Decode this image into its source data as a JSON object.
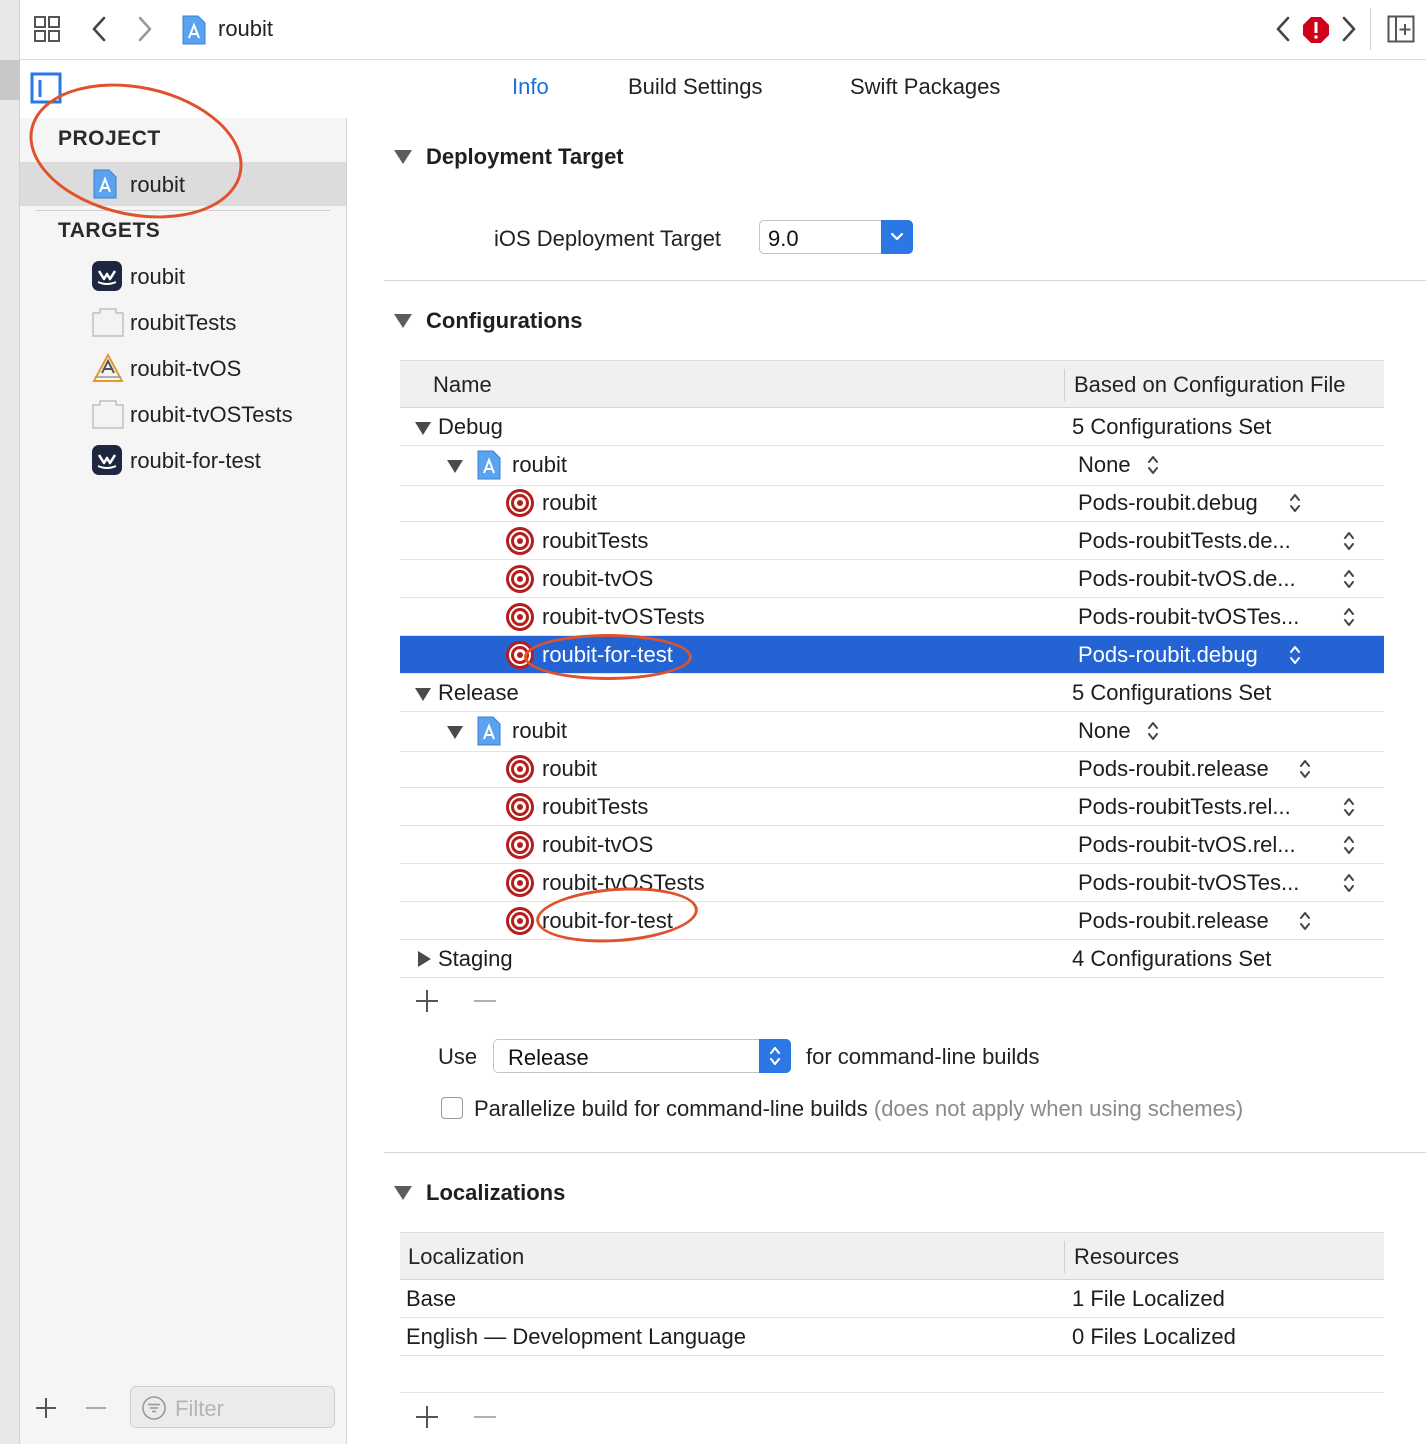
{
  "window": {
    "title": "roubit"
  },
  "tabs": [
    {
      "label": "Info",
      "active": true
    },
    {
      "label": "Build Settings",
      "active": false
    },
    {
      "label": "Swift Packages",
      "active": false
    }
  ],
  "sidebar": {
    "project_header": "PROJECT",
    "project_item": {
      "label": "roubit",
      "icon": "xcode-project-icon"
    },
    "targets_header": "TARGETS",
    "targets": [
      {
        "label": "roubit",
        "icon": "app-icon"
      },
      {
        "label": "roubitTests",
        "icon": "test-bundle-icon"
      },
      {
        "label": "roubit-tvOS",
        "icon": "tvos-app-icon"
      },
      {
        "label": "roubit-tvOSTests",
        "icon": "test-bundle-icon"
      },
      {
        "label": "roubit-for-test",
        "icon": "app-icon"
      }
    ],
    "filter_placeholder": "Filter"
  },
  "deployment": {
    "header": "Deployment Target",
    "ios_label": "iOS Deployment Target",
    "ios_value": "9.0"
  },
  "configurations": {
    "header": "Configurations",
    "columns": [
      "Name",
      "Based on Configuration File"
    ],
    "rows": [
      {
        "kind": "group",
        "name": "Debug",
        "value": "5 Configurations Set"
      },
      {
        "kind": "project",
        "name": "roubit",
        "value": "None"
      },
      {
        "kind": "target",
        "name": "roubit",
        "value": "Pods-roubit.debug"
      },
      {
        "kind": "target",
        "name": "roubitTests",
        "value": "Pods-roubitTests.de..."
      },
      {
        "kind": "target",
        "name": "roubit-tvOS",
        "value": "Pods-roubit-tvOS.de..."
      },
      {
        "kind": "target",
        "name": "roubit-tvOSTests",
        "value": "Pods-roubit-tvOSTes..."
      },
      {
        "kind": "target",
        "name": "roubit-for-test",
        "value": "Pods-roubit.debug",
        "selected": true
      },
      {
        "kind": "group",
        "name": "Release",
        "value": "5 Configurations Set"
      },
      {
        "kind": "project",
        "name": "roubit",
        "value": "None"
      },
      {
        "kind": "target",
        "name": "roubit",
        "value": "Pods-roubit.release"
      },
      {
        "kind": "target",
        "name": "roubitTests",
        "value": "Pods-roubitTests.rel..."
      },
      {
        "kind": "target",
        "name": "roubit-tvOS",
        "value": "Pods-roubit-tvOS.rel..."
      },
      {
        "kind": "target",
        "name": "roubit-tvOSTests",
        "value": "Pods-roubit-tvOSTes..."
      },
      {
        "kind": "target",
        "name": "roubit-for-test",
        "value": "Pods-roubit.release"
      },
      {
        "kind": "group-collapsed",
        "name": "Staging",
        "value": "4 Configurations Set"
      }
    ],
    "use_label": "Use",
    "use_value": "Release",
    "use_suffix": "for command-line builds",
    "parallelize_label": "Parallelize build for command-line builds",
    "parallelize_note": "(does not apply when using schemes)",
    "parallelize_checked": false
  },
  "localizations": {
    "header": "Localizations",
    "columns": [
      "Localization",
      "Resources"
    ],
    "rows": [
      {
        "name": "Base",
        "value": "1 File Localized"
      },
      {
        "name": "English — Development Language",
        "value": "0 Files Localized"
      }
    ]
  },
  "colors": {
    "accent": "#2463d4",
    "annotation": "#e0522c",
    "error": "#d0021b"
  }
}
